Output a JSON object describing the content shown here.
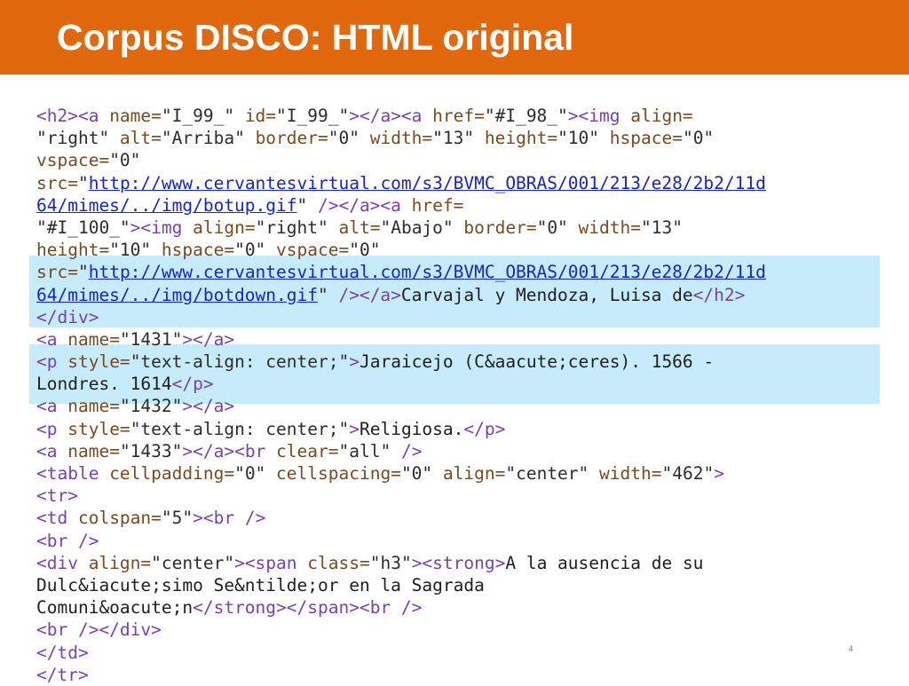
{
  "slide": {
    "title": "Corpus DISCO: HTML original",
    "page_number": "4"
  },
  "colors": {
    "title_bar": "#e2680e",
    "title_text": "#ffffff",
    "highlight": "#c6ecfc",
    "tag": "#7a3fb0",
    "attribute": "#7a4a1e",
    "string": "#2c2c2c",
    "link": "#1426c9",
    "text": "#1e1e1e"
  },
  "code_lines": [
    [
      [
        "tag",
        "<h2><a "
      ],
      [
        "attr",
        "name="
      ],
      [
        "str",
        "\"I_99_\" "
      ],
      [
        "attr",
        "id="
      ],
      [
        "str",
        "\"I_99_\""
      ],
      [
        "tag",
        "></a><a "
      ],
      [
        "attr",
        "href="
      ],
      [
        "str",
        "\"#I_98_\""
      ],
      [
        "tag",
        "><img "
      ],
      [
        "attr",
        "align="
      ]
    ],
    [
      [
        "str",
        "\"right\" "
      ],
      [
        "attr",
        "alt="
      ],
      [
        "str",
        "\"Arriba\" "
      ],
      [
        "attr",
        "border="
      ],
      [
        "str",
        "\"0\" "
      ],
      [
        "attr",
        "width="
      ],
      [
        "str",
        "\"13\" "
      ],
      [
        "attr",
        "height="
      ],
      [
        "str",
        "\"10\" "
      ],
      [
        "attr",
        "hspace="
      ],
      [
        "str",
        "\"0\""
      ]
    ],
    [
      [
        "attr",
        "vspace="
      ],
      [
        "str",
        "\"0\""
      ]
    ],
    [
      [
        "attr",
        "src="
      ],
      [
        "str",
        "\""
      ],
      [
        "link",
        "http://www.cervantesvirtual.com/s3/BVMC_OBRAS/001/213/e28/2b2/11d"
      ]
    ],
    [
      [
        "link",
        "64/mimes/../img/botup.gif"
      ],
      [
        "str",
        "\" "
      ],
      [
        "tag",
        "/></a><a "
      ],
      [
        "attr",
        "href="
      ]
    ],
    [
      [
        "str",
        "\"#I_100_\""
      ],
      [
        "tag",
        "><img "
      ],
      [
        "attr",
        "align="
      ],
      [
        "str",
        "\"right\" "
      ],
      [
        "attr",
        "alt="
      ],
      [
        "str",
        "\"Abajo\" "
      ],
      [
        "attr",
        "border="
      ],
      [
        "str",
        "\"0\" "
      ],
      [
        "attr",
        "width="
      ],
      [
        "str",
        "\"13\""
      ]
    ],
    [
      [
        "attr",
        "height="
      ],
      [
        "str",
        "\"10\" "
      ],
      [
        "attr",
        "hspace="
      ],
      [
        "str",
        "\"0\" "
      ],
      [
        "attr",
        "vspace="
      ],
      [
        "str",
        "\"0\""
      ]
    ],
    [
      [
        "attr",
        "src="
      ],
      [
        "str",
        "\""
      ],
      [
        "link",
        "http://www.cervantesvirtual.com/s3/BVMC_OBRAS/001/213/e28/2b2/11d"
      ]
    ],
    [
      [
        "link",
        "64/mimes/../img/botdown.gif"
      ],
      [
        "str",
        "\" "
      ],
      [
        "tag",
        "/></a>"
      ],
      [
        "text",
        "Carvajal y Mendoza, Luisa de"
      ],
      [
        "tag",
        "</h2>"
      ]
    ],
    [
      [
        "tag",
        "</div>"
      ]
    ],
    [
      [
        "tag",
        "<a "
      ],
      [
        "attr",
        "name="
      ],
      [
        "str",
        "\"1431\""
      ],
      [
        "tag",
        "></a>"
      ]
    ],
    [
      [
        "tag",
        "<p "
      ],
      [
        "attr",
        "style="
      ],
      [
        "str",
        "\"text-align: center;\""
      ],
      [
        "tag",
        ">"
      ],
      [
        "text",
        "Jaraicejo (C&aacute;ceres). 1566 -"
      ]
    ],
    [
      [
        "text",
        "Londres. 1614"
      ],
      [
        "tag",
        "</p>"
      ]
    ],
    [
      [
        "tag",
        "<a "
      ],
      [
        "attr",
        "name="
      ],
      [
        "str",
        "\"1432\""
      ],
      [
        "tag",
        "></a>"
      ]
    ],
    [
      [
        "tag",
        "<p "
      ],
      [
        "attr",
        "style="
      ],
      [
        "str",
        "\"text-align: center;\""
      ],
      [
        "tag",
        ">"
      ],
      [
        "text",
        "Religiosa."
      ],
      [
        "tag",
        "</p>"
      ]
    ],
    [
      [
        "tag",
        "<a "
      ],
      [
        "attr",
        "name="
      ],
      [
        "str",
        "\"1433\""
      ],
      [
        "tag",
        "></a><br "
      ],
      [
        "attr",
        "clear="
      ],
      [
        "str",
        "\"all\" "
      ],
      [
        "tag",
        "/>"
      ]
    ],
    [
      [
        "tag",
        "<table "
      ],
      [
        "attr",
        "cellpadding="
      ],
      [
        "str",
        "\"0\" "
      ],
      [
        "attr",
        "cellspacing="
      ],
      [
        "str",
        "\"0\" "
      ],
      [
        "attr",
        "align="
      ],
      [
        "str",
        "\"center\" "
      ],
      [
        "attr",
        "width="
      ],
      [
        "str",
        "\"462\""
      ],
      [
        "tag",
        ">"
      ]
    ],
    [
      [
        "tag",
        "<tr>"
      ]
    ],
    [
      [
        "tag",
        "<td "
      ],
      [
        "attr",
        "colspan="
      ],
      [
        "str",
        "\"5\""
      ],
      [
        "tag",
        "><br />"
      ]
    ],
    [
      [
        "tag",
        "<br />"
      ]
    ],
    [
      [
        "tag",
        "<div "
      ],
      [
        "attr",
        "align="
      ],
      [
        "str",
        "\"center\""
      ],
      [
        "tag",
        "><span "
      ],
      [
        "attr",
        "class="
      ],
      [
        "str",
        "\"h3\""
      ],
      [
        "tag",
        "><strong>"
      ],
      [
        "text",
        "A la ausencia de su"
      ]
    ],
    [
      [
        "text",
        "Dulc&iacute;simo Se&ntilde;or en la Sagrada"
      ]
    ],
    [
      [
        "text",
        "Comuni&oacute;n"
      ],
      [
        "tag",
        "</strong></span><br />"
      ]
    ],
    [
      [
        "tag",
        "<br /></div>"
      ]
    ],
    [
      [
        "tag",
        "</td>"
      ]
    ],
    [
      [
        "tag",
        "</tr>"
      ]
    ]
  ]
}
